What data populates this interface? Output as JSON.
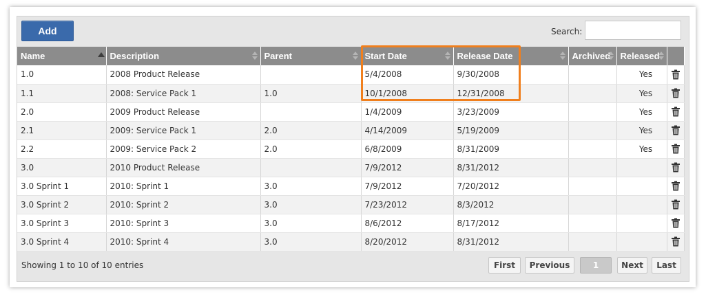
{
  "toolbar": {
    "add_label": "Add",
    "search_label": "Search:",
    "search_value": ""
  },
  "columns": [
    "Name",
    "Description",
    "Parent",
    "Start Date",
    "Release Date",
    "Archived",
    "Released"
  ],
  "rows": [
    {
      "name": "1.0",
      "description": "2008 Product Release",
      "parent": "",
      "start": "5/4/2008",
      "release": "9/30/2008",
      "archived": "",
      "released": "Yes"
    },
    {
      "name": "1.1",
      "description": "2008: Service Pack 1",
      "parent": "1.0",
      "start": "10/1/2008",
      "release": "12/31/2008",
      "archived": "",
      "released": "Yes"
    },
    {
      "name": "2.0",
      "description": "2009 Product Release",
      "parent": "",
      "start": "1/4/2009",
      "release": "3/23/2009",
      "archived": "",
      "released": "Yes"
    },
    {
      "name": "2.1",
      "description": "2009: Service Pack 1",
      "parent": "2.0",
      "start": "4/14/2009",
      "release": "5/19/2009",
      "archived": "",
      "released": "Yes"
    },
    {
      "name": "2.2",
      "description": "2009: Service Pack 2",
      "parent": "2.0",
      "start": "6/8/2009",
      "release": "8/31/2009",
      "archived": "",
      "released": "Yes"
    },
    {
      "name": "3.0",
      "description": "2010 Product Release",
      "parent": "",
      "start": "7/9/2012",
      "release": "8/31/2012",
      "archived": "",
      "released": ""
    },
    {
      "name": "3.0 Sprint 1",
      "description": "2010: Sprint 1",
      "parent": "3.0",
      "start": "7/9/2012",
      "release": "7/20/2012",
      "archived": "",
      "released": ""
    },
    {
      "name": "3.0 Sprint 2",
      "description": "2010: Sprint 2",
      "parent": "3.0",
      "start": "7/23/2012",
      "release": "8/3/2012",
      "archived": "",
      "released": ""
    },
    {
      "name": "3.0 Sprint 3",
      "description": "2010: Sprint 3",
      "parent": "3.0",
      "start": "8/6/2012",
      "release": "8/17/2012",
      "archived": "",
      "released": ""
    },
    {
      "name": "3.0 Sprint 4",
      "description": "2010: Sprint 4",
      "parent": "3.0",
      "start": "8/20/2012",
      "release": "8/31/2012",
      "archived": "",
      "released": ""
    }
  ],
  "footer": {
    "info": "Showing 1 to 10 of 10 entries",
    "first": "First",
    "previous": "Previous",
    "page": "1",
    "next": "Next",
    "last": "Last"
  },
  "colors": {
    "header": "#8c8c8c",
    "add_button": "#3a6aab",
    "highlight": "#f07f1d"
  },
  "icons": {
    "delete": "trash-icon",
    "sort": "sort-icon",
    "sort_active": "sort-ascending-icon"
  }
}
